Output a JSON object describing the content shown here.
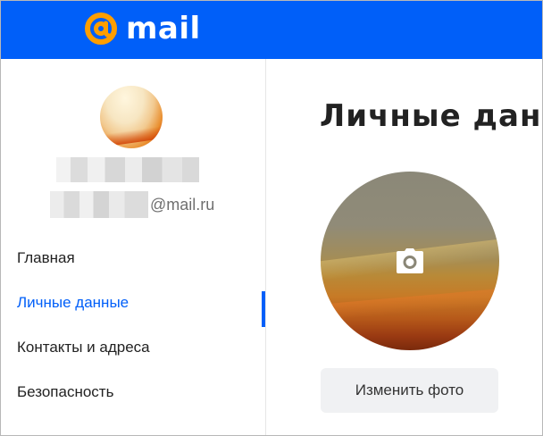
{
  "brand": {
    "name": "mail",
    "at_color": "#ff9e00",
    "header_color": "#005ff9"
  },
  "profile": {
    "email_domain": "@mail.ru"
  },
  "nav": {
    "items": [
      {
        "label": "Главная",
        "active": false
      },
      {
        "label": "Личные данные",
        "active": true
      },
      {
        "label": "Контакты и адреса",
        "active": false
      },
      {
        "label": "Безопасность",
        "active": false
      }
    ]
  },
  "main": {
    "title": "Личные данные",
    "change_photo_label": "Изменить фото"
  },
  "icons": {
    "camera": "camera-icon",
    "logo_at": "at-sign-icon"
  }
}
